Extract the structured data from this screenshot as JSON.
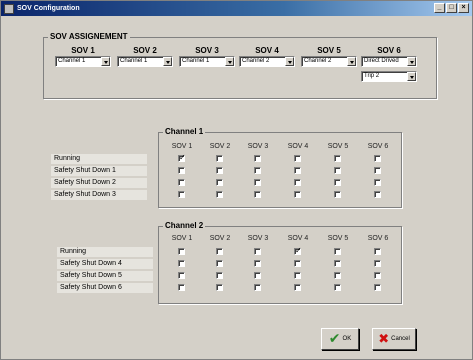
{
  "window": {
    "title": "SOV Configuration",
    "controls": {
      "minimize": "_",
      "maximize": "□",
      "close": "×"
    }
  },
  "assignment": {
    "title": "SOV ASSIGNEMENT",
    "sovs": [
      {
        "label": "SOV 1",
        "value": "Channel 1"
      },
      {
        "label": "SOV 2",
        "value": "Channel 1"
      },
      {
        "label": "SOV 3",
        "value": "Channel 1"
      },
      {
        "label": "SOV 4",
        "value": "Channel 2"
      },
      {
        "label": "SOV 5",
        "value": "Channel 2"
      },
      {
        "label": "SOV 6",
        "value": "Direct Drived",
        "extra_value": "Trip 2"
      }
    ]
  },
  "channel1": {
    "title": "Channel 1",
    "columns": [
      "SOV 1",
      "SOV 2",
      "SOV 3",
      "SOV 4",
      "SOV 5",
      "SOV 6"
    ],
    "rows": [
      {
        "label": "Running",
        "checks": [
          true,
          false,
          false,
          false,
          false,
          false
        ]
      },
      {
        "label": "Safety Shut Down 1",
        "checks": [
          false,
          false,
          false,
          false,
          false,
          false
        ]
      },
      {
        "label": "Safety Shut Down 2",
        "checks": [
          false,
          false,
          false,
          false,
          false,
          false
        ]
      },
      {
        "label": "Safety Shut Down 3",
        "checks": [
          false,
          false,
          false,
          false,
          false,
          false
        ]
      }
    ]
  },
  "channel2": {
    "title": "Channel 2",
    "columns": [
      "SOV 1",
      "SOV 2",
      "SOV 3",
      "SOV 4",
      "SOV 5",
      "SOV 6"
    ],
    "rows": [
      {
        "label": "Running",
        "checks": [
          false,
          false,
          false,
          true,
          false,
          false
        ]
      },
      {
        "label": "Safety Shut Down 4",
        "checks": [
          false,
          false,
          false,
          false,
          false,
          false
        ]
      },
      {
        "label": "Safety Shut Down 5",
        "checks": [
          false,
          false,
          false,
          false,
          false,
          false
        ]
      },
      {
        "label": "Safety Shut Down 6",
        "checks": [
          false,
          false,
          false,
          false,
          false,
          false
        ]
      }
    ]
  },
  "buttons": {
    "ok_label": "OK",
    "cancel_label": "Cancel",
    "ok_icon": "checkmark-icon",
    "cancel_icon": "x-icon"
  }
}
